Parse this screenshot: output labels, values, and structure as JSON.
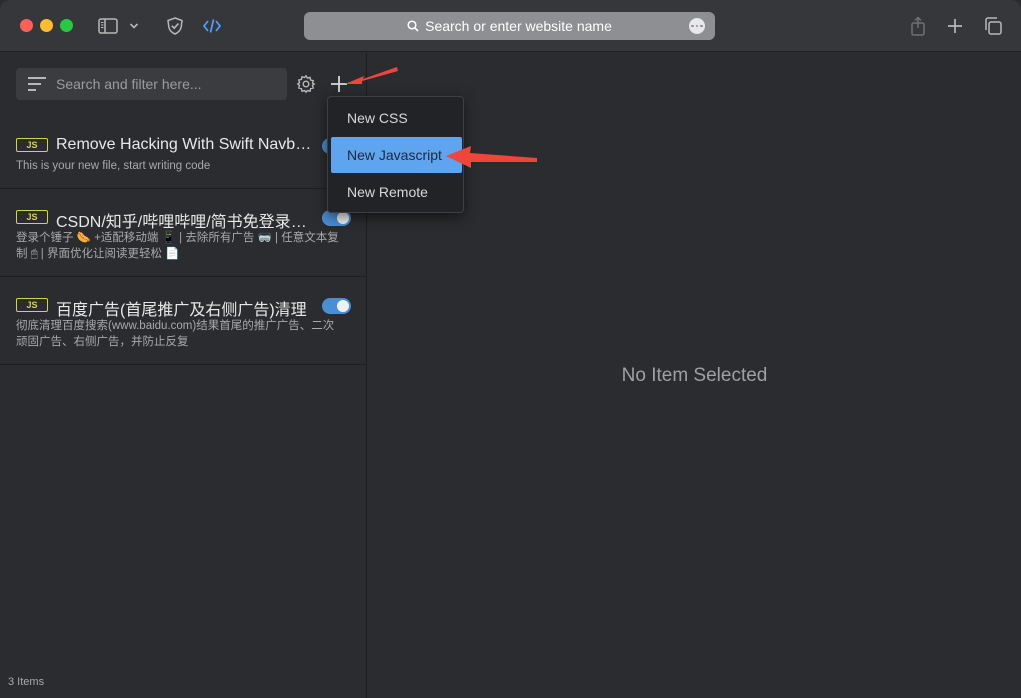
{
  "toolbar": {
    "url_placeholder": "Search or enter website name"
  },
  "sidebar": {
    "search_placeholder": "Search and filter here...",
    "items": [
      {
        "badge": "JS",
        "title": "Remove Hacking With Swift Navbar...",
        "description": "This is your new file, start writing code",
        "enabled": true
      },
      {
        "badge": "JS",
        "title": "CSDN/知乎/哔哩哔哩/简书免登录去...",
        "description_line1": "登录个锤子 🌭 +适配移动端 📱 | 去除所有广告 🥽 | 任意文本复",
        "description_line2": "制 🖱 | 界面优化让阅读更轻松 📄",
        "enabled": true
      },
      {
        "badge": "JS",
        "title": "百度广告(首尾推广及右侧广告)清理",
        "description_line1": "彻底清理百度搜索(www.baidu.com)结果首尾的推广广告、二次",
        "description_line2": "顽固广告、右侧广告，并防止反复",
        "enabled": true
      }
    ],
    "count": "3 Items"
  },
  "dropdown": {
    "items": [
      "New CSS",
      "New Javascript",
      "New Remote"
    ],
    "selected": "New Javascript"
  },
  "main": {
    "empty_text": "No Item Selected"
  },
  "colors": {
    "accent": "#5ea4ee",
    "toggle": "#4a8fd4",
    "badge": "#d8d24a",
    "annotation_arrow": "#f0453a"
  }
}
